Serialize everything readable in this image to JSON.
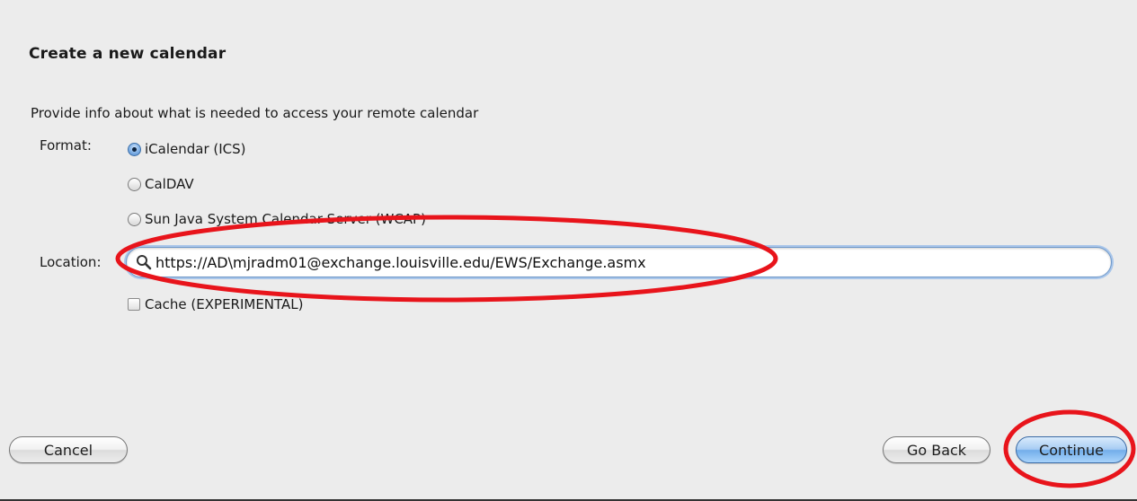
{
  "dialog": {
    "title": "Create a new calendar",
    "description": "Provide info about what is needed to access your remote calendar"
  },
  "format": {
    "label": "Format:",
    "options": [
      {
        "label": "iCalendar (ICS)",
        "selected": true
      },
      {
        "label": "CalDAV",
        "selected": false
      },
      {
        "label": "Sun Java System Calendar Server (WCAP)",
        "selected": false
      }
    ]
  },
  "location": {
    "label": "Location:",
    "value": "https://AD\\mjradm01@exchange.louisville.edu/EWS/Exchange.asmx",
    "icon": "magnifier-icon"
  },
  "cache": {
    "label": "Cache (EXPERIMENTAL)",
    "checked": false
  },
  "buttons": {
    "cancel": "Cancel",
    "go_back": "Go Back",
    "continue": "Continue"
  },
  "colors": {
    "annotation": "#e8141b",
    "field_focus": "#a9c6ea",
    "default_button": "#72aeea"
  }
}
